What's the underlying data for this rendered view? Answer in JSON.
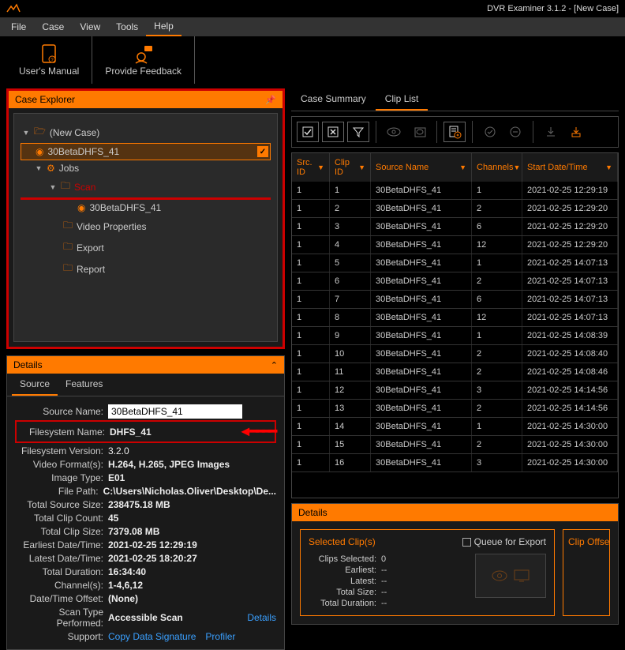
{
  "window": {
    "title": "DVR Examiner 3.1.2 - [New Case]"
  },
  "menu": [
    "File",
    "Case",
    "View",
    "Tools",
    "Help"
  ],
  "menu_active": 4,
  "toolbar": {
    "manual": "User's Manual",
    "feedback": "Provide Feedback"
  },
  "case_explorer": {
    "title": "Case Explorer",
    "nodes": {
      "root": "(New Case)",
      "source": "30BetaDHFS_41",
      "jobs": "Jobs",
      "scan": "Scan",
      "scan_src": "30BetaDHFS_41",
      "video_props": "Video Properties",
      "export": "Export",
      "report": "Report"
    }
  },
  "details": {
    "title": "Details",
    "tabs": [
      "Source",
      "Features"
    ],
    "active_tab": 0,
    "rows": {
      "source_name_label": "Source Name:",
      "source_name_value": "30BetaDHFS_41",
      "filesystem_name_label": "Filesystem Name:",
      "filesystem_name_value": "DHFS_41",
      "filesystem_version_label": "Filesystem Version:",
      "filesystem_version_value": "3.2.0",
      "video_formats_label": "Video Format(s):",
      "video_formats_value": "H.264, H.265, JPEG Images",
      "image_type_label": "Image Type:",
      "image_type_value": "E01",
      "file_path_label": "File Path:",
      "file_path_value": "C:\\Users\\Nicholas.Oliver\\Desktop\\De...",
      "total_source_size_label": "Total Source Size:",
      "total_source_size_value": "238475.18 MB",
      "total_clip_count_label": "Total Clip Count:",
      "total_clip_count_value": "45",
      "total_clip_size_label": "Total Clip Size:",
      "total_clip_size_value": "7379.08 MB",
      "earliest_dt_label": "Earliest Date/Time:",
      "earliest_dt_value": "2021-02-25 12:29:19",
      "latest_dt_label": "Latest Date/Time:",
      "latest_dt_value": "2021-02-25 18:20:27",
      "total_duration_label": "Total Duration:",
      "total_duration_value": "16:34:40",
      "channels_label": "Channel(s):",
      "channels_value": "1-4,6,12",
      "dt_offset_label": "Date/Time Offset:",
      "dt_offset_value": "(None)",
      "scan_type_label": "Scan Type Performed:",
      "scan_type_value": "Accessible Scan",
      "scan_type_link": "Details",
      "support_label": "Support:",
      "support_link1": "Copy Data Signature",
      "support_link2": "Profiler"
    }
  },
  "right_tabs": {
    "items": [
      "Case Summary",
      "Clip List"
    ],
    "active": 1
  },
  "clip_table": {
    "headers": [
      "Src. ID",
      "Clip ID",
      "Source Name",
      "Channels",
      "Start Date/Time"
    ],
    "rows": [
      {
        "src": "1",
        "clip": "1",
        "name": "30BetaDHFS_41",
        "ch": "1",
        "dt": "2021-02-25 12:29:19"
      },
      {
        "src": "1",
        "clip": "2",
        "name": "30BetaDHFS_41",
        "ch": "2",
        "dt": "2021-02-25 12:29:20"
      },
      {
        "src": "1",
        "clip": "3",
        "name": "30BetaDHFS_41",
        "ch": "6",
        "dt": "2021-02-25 12:29:20"
      },
      {
        "src": "1",
        "clip": "4",
        "name": "30BetaDHFS_41",
        "ch": "12",
        "dt": "2021-02-25 12:29:20"
      },
      {
        "src": "1",
        "clip": "5",
        "name": "30BetaDHFS_41",
        "ch": "1",
        "dt": "2021-02-25 14:07:13"
      },
      {
        "src": "1",
        "clip": "6",
        "name": "30BetaDHFS_41",
        "ch": "2",
        "dt": "2021-02-25 14:07:13"
      },
      {
        "src": "1",
        "clip": "7",
        "name": "30BetaDHFS_41",
        "ch": "6",
        "dt": "2021-02-25 14:07:13"
      },
      {
        "src": "1",
        "clip": "8",
        "name": "30BetaDHFS_41",
        "ch": "12",
        "dt": "2021-02-25 14:07:13"
      },
      {
        "src": "1",
        "clip": "9",
        "name": "30BetaDHFS_41",
        "ch": "1",
        "dt": "2021-02-25 14:08:39"
      },
      {
        "src": "1",
        "clip": "10",
        "name": "30BetaDHFS_41",
        "ch": "2",
        "dt": "2021-02-25 14:08:40"
      },
      {
        "src": "1",
        "clip": "11",
        "name": "30BetaDHFS_41",
        "ch": "2",
        "dt": "2021-02-25 14:08:46"
      },
      {
        "src": "1",
        "clip": "12",
        "name": "30BetaDHFS_41",
        "ch": "3",
        "dt": "2021-02-25 14:14:56"
      },
      {
        "src": "1",
        "clip": "13",
        "name": "30BetaDHFS_41",
        "ch": "2",
        "dt": "2021-02-25 14:14:56"
      },
      {
        "src": "1",
        "clip": "14",
        "name": "30BetaDHFS_41",
        "ch": "1",
        "dt": "2021-02-25 14:30:00"
      },
      {
        "src": "1",
        "clip": "15",
        "name": "30BetaDHFS_41",
        "ch": "2",
        "dt": "2021-02-25 14:30:00"
      },
      {
        "src": "1",
        "clip": "16",
        "name": "30BetaDHFS_41",
        "ch": "3",
        "dt": "2021-02-25 14:30:00"
      }
    ]
  },
  "bottom_details": {
    "title": "Details",
    "selected_clips_title": "Selected Clip(s)",
    "queue_for_export": "Queue for Export",
    "clip_offset_title": "Clip Offse",
    "rows": {
      "clips_selected_label": "Clips Selected:",
      "clips_selected_value": "0",
      "earliest_label": "Earliest:",
      "earliest_value": "--",
      "latest_label": "Latest:",
      "latest_value": "--",
      "total_size_label": "Total Size:",
      "total_size_value": "--",
      "total_duration_label": "Total Duration:",
      "total_duration_value": "--"
    }
  }
}
